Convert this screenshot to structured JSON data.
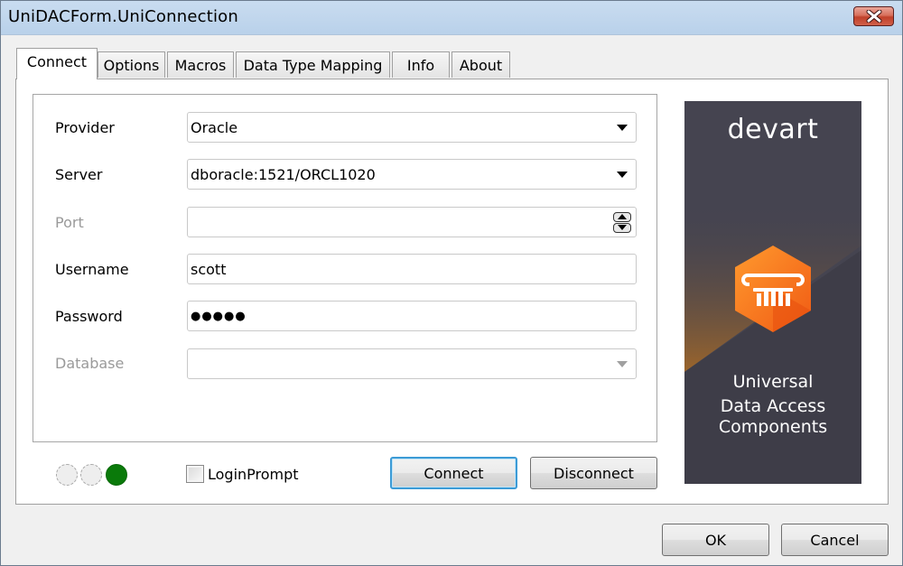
{
  "window": {
    "title": "UniDACForm.UniConnection",
    "close_icon": "close-icon"
  },
  "tabs": [
    {
      "label": "Connect",
      "active": true
    },
    {
      "label": "Options",
      "active": false
    },
    {
      "label": "Macros",
      "active": false
    },
    {
      "label": "Data Type Mapping",
      "active": false
    },
    {
      "label": "Info",
      "active": false
    },
    {
      "label": "About",
      "active": false
    }
  ],
  "form": {
    "provider": {
      "label": "Provider",
      "value": "Oracle",
      "type": "combobox",
      "enabled": true
    },
    "server": {
      "label": "Server",
      "value": "dboracle:1521/ORCL1020",
      "type": "combobox",
      "enabled": true
    },
    "port": {
      "label": "Port",
      "value": "",
      "type": "spin-edit",
      "enabled": false
    },
    "username": {
      "label": "Username",
      "value": "scott",
      "type": "text",
      "enabled": true
    },
    "password": {
      "label": "Password",
      "value": "●●●●●",
      "type": "password",
      "enabled": true
    },
    "database": {
      "label": "Database",
      "value": "",
      "type": "combobox",
      "enabled": false
    }
  },
  "status": {
    "indicators": [
      {
        "state": "off",
        "color": "#eeeeee"
      },
      {
        "state": "off",
        "color": "#eeeeee"
      },
      {
        "state": "on",
        "color": "#0a7a0a"
      }
    ]
  },
  "login_prompt": {
    "label": "LoginPrompt",
    "checked": false
  },
  "buttons": {
    "connect": "Connect",
    "disconnect": "Disconnect",
    "ok": "OK",
    "cancel": "Cancel"
  },
  "banner": {
    "brand": "devart",
    "line1": "Universal",
    "line2": "Data Access",
    "line3": "Components",
    "logo_icon": "column-pillar-icon",
    "accent_color": "#f47b20",
    "background_color": "#454450"
  }
}
